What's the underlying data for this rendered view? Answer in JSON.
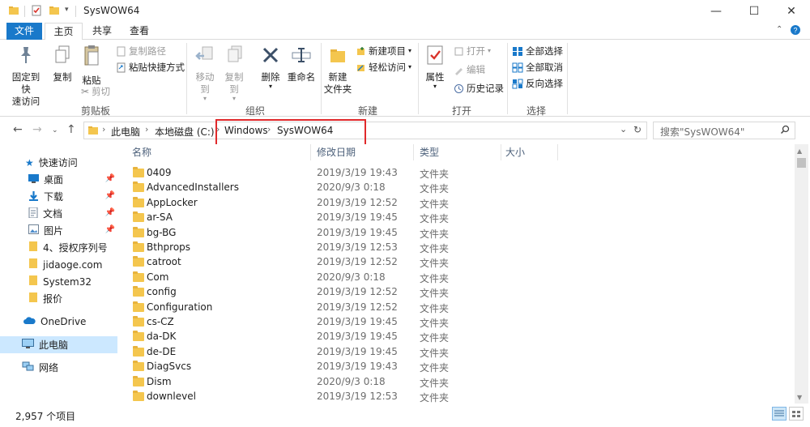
{
  "window": {
    "title": "SysWOW64",
    "minimize_glyph": "—",
    "maximize_glyph": "☐",
    "close_glyph": "✕"
  },
  "ribbon_tabs": [
    "文件",
    "主页",
    "共享",
    "查看"
  ],
  "ribbon": {
    "clipboard": {
      "pin_label_line1": "固定到快",
      "pin_label_line2": "速访问",
      "copy": "复制",
      "paste": "粘贴",
      "copy_path": "复制路径",
      "paste_shortcut": "粘贴快捷方式",
      "cut": "剪切",
      "group": "剪贴板"
    },
    "organize": {
      "move_to": "移动到",
      "copy_to": "复制到",
      "delete": "删除",
      "rename": "重命名",
      "group": "组织"
    },
    "new": {
      "new_folder_line1": "新建",
      "new_folder_line2": "文件夹",
      "new_item": "新建项目",
      "easy_access": "轻松访问",
      "group": "新建"
    },
    "open": {
      "properties": "属性",
      "open": "打开",
      "edit": "编辑",
      "history": "历史记录",
      "group": "打开"
    },
    "select": {
      "select_all": "全部选择",
      "select_none": "全部取消",
      "invert": "反向选择",
      "group": "选择"
    }
  },
  "address": {
    "crumbs": [
      "此电脑",
      "本地磁盘 (C:)",
      "Windows",
      "SysWOW64"
    ],
    "search_placeholder": "搜索\"SysWOW64\""
  },
  "nav": {
    "quick_access": "快速访问",
    "items": [
      {
        "label": "桌面",
        "icon": "desktop-icon",
        "pinned": true
      },
      {
        "label": "下载",
        "icon": "download-icon",
        "pinned": true
      },
      {
        "label": "文档",
        "icon": "document-icon",
        "pinned": true
      },
      {
        "label": "图片",
        "icon": "picture-icon",
        "pinned": true
      },
      {
        "label": "4、授权序列号",
        "icon": "folder-icon",
        "pinned": false
      },
      {
        "label": "jidaoge.com",
        "icon": "folder-icon",
        "pinned": false
      },
      {
        "label": "System32",
        "icon": "folder-icon",
        "pinned": false
      },
      {
        "label": "报价",
        "icon": "folder-icon",
        "pinned": false
      }
    ],
    "onedrive": "OneDrive",
    "this_pc": "此电脑",
    "network": "网络"
  },
  "columns": {
    "name": "名称",
    "date": "修改日期",
    "type": "类型",
    "size": "大小"
  },
  "files": [
    {
      "name": "0409",
      "date": "2019/3/19 19:43",
      "type": "文件夹"
    },
    {
      "name": "AdvancedInstallers",
      "date": "2020/9/3 0:18",
      "type": "文件夹"
    },
    {
      "name": "AppLocker",
      "date": "2019/3/19 12:52",
      "type": "文件夹"
    },
    {
      "name": "ar-SA",
      "date": "2019/3/19 19:45",
      "type": "文件夹"
    },
    {
      "name": "bg-BG",
      "date": "2019/3/19 19:45",
      "type": "文件夹"
    },
    {
      "name": "Bthprops",
      "date": "2019/3/19 12:53",
      "type": "文件夹"
    },
    {
      "name": "catroot",
      "date": "2019/3/19 12:52",
      "type": "文件夹"
    },
    {
      "name": "Com",
      "date": "2020/9/3 0:18",
      "type": "文件夹"
    },
    {
      "name": "config",
      "date": "2019/3/19 12:52",
      "type": "文件夹"
    },
    {
      "name": "Configuration",
      "date": "2019/3/19 12:52",
      "type": "文件夹"
    },
    {
      "name": "cs-CZ",
      "date": "2019/3/19 19:45",
      "type": "文件夹"
    },
    {
      "name": "da-DK",
      "date": "2019/3/19 19:45",
      "type": "文件夹"
    },
    {
      "name": "de-DE",
      "date": "2019/3/19 19:45",
      "type": "文件夹"
    },
    {
      "name": "DiagSvcs",
      "date": "2019/3/19 19:43",
      "type": "文件夹"
    },
    {
      "name": "Dism",
      "date": "2020/9/3 0:18",
      "type": "文件夹"
    },
    {
      "name": "downlevel",
      "date": "2019/3/19 12:53",
      "type": "文件夹"
    }
  ],
  "status": {
    "item_count": "2,957 个项目"
  },
  "colors": {
    "accent": "#1979ca",
    "selection": "#cce8ff",
    "highlight_box": "#e0292b",
    "folder": "#f4c64e"
  }
}
